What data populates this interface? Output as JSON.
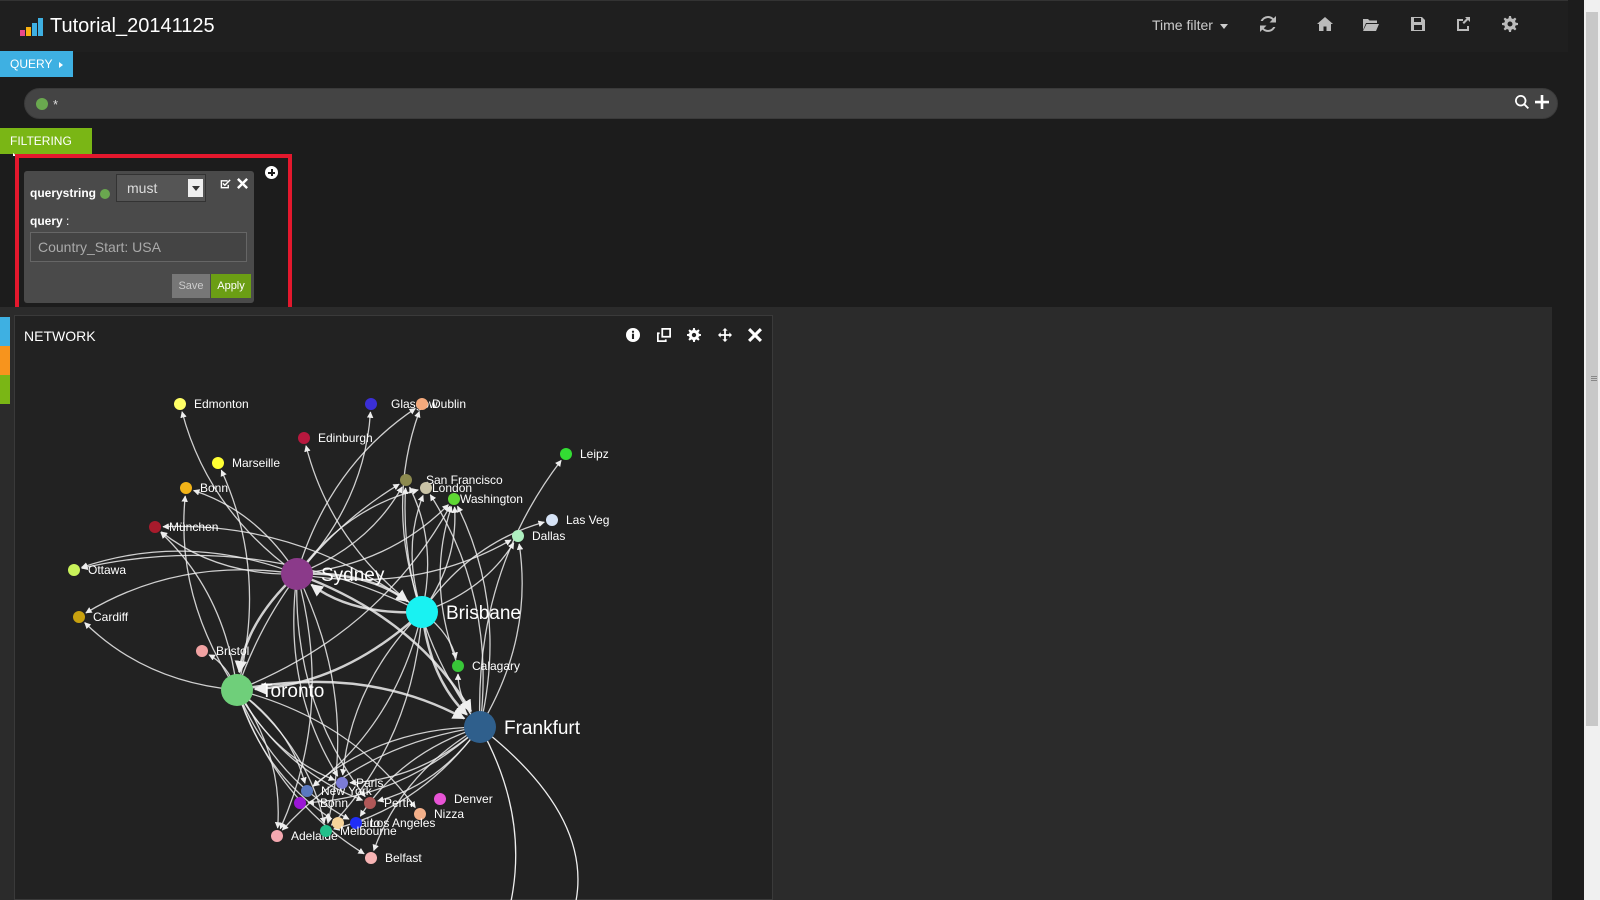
{
  "app": {
    "title": "Tutorial_20141125",
    "logo_icon": "kibana-bar-logo-icon"
  },
  "navbar": {
    "time_filter_label": "Time filter",
    "icons": [
      "refresh-icon",
      "home-icon",
      "folder-open-icon",
      "save-icon",
      "share-icon",
      "gear-icon"
    ]
  },
  "query_section": {
    "tab_label": "QUERY",
    "query_value": "*",
    "actions": [
      "search-icon",
      "plus-icon"
    ]
  },
  "filtering_section": {
    "tab_label": "FILTERING",
    "filter": {
      "type_label": "querystring",
      "mode_value": "must",
      "query_label": "query",
      "query_suffix": " :",
      "query_value": "Country_Start: USA",
      "save_label": "Save",
      "apply_label": "Apply"
    }
  },
  "colors": {
    "query_tab": "#3eb0e2",
    "filter_tab": "#7ab615",
    "highlight": "#e3182d",
    "apply": "#6b9e14"
  },
  "network_panel": {
    "title": "NETWORK",
    "tools": [
      "info-icon",
      "copy-icon",
      "gear-icon",
      "move-icon",
      "close-icon"
    ],
    "nodes": [
      {
        "id": "Edmonton",
        "label": "Edmonton",
        "color": "#ffff66",
        "size": "small"
      },
      {
        "id": "Glasgow",
        "label": "Glasgow",
        "color": "#3b2fd6",
        "size": "small"
      },
      {
        "id": "Dublin",
        "label": "Dublin",
        "color": "#f4a97c",
        "size": "small"
      },
      {
        "id": "Edinburgh",
        "label": "Edinburgh",
        "color": "#b8183e",
        "size": "small"
      },
      {
        "id": "Leipz",
        "label": "Leipz",
        "color": "#33dd33",
        "size": "small"
      },
      {
        "id": "Marseille",
        "label": "Marseille",
        "color": "#ffff33",
        "size": "small"
      },
      {
        "id": "SanFrancisco",
        "label": "San Francisco",
        "color": "#8c8a4f",
        "size": "small"
      },
      {
        "id": "London",
        "label": "London",
        "color": "#c9c3a6",
        "size": "small"
      },
      {
        "id": "Washington",
        "label": "Washington",
        "color": "#5fd833",
        "size": "small"
      },
      {
        "id": "Bonn",
        "label": "Bonn",
        "color": "#f2b318",
        "size": "small"
      },
      {
        "id": "LasVeg",
        "label": "Las Veg",
        "color": "#d6e3f6",
        "size": "small"
      },
      {
        "id": "Dallas",
        "label": "Dallas",
        "color": "#aef0c0",
        "size": "small"
      },
      {
        "id": "Munchen",
        "label": "München",
        "color": "#a81b2c",
        "size": "small"
      },
      {
        "id": "Sydney",
        "label": "Sydney",
        "color": "#8b3a8a",
        "size": "large"
      },
      {
        "id": "Ottawa",
        "label": "Ottawa",
        "color": "#c9f25a",
        "size": "small"
      },
      {
        "id": "Brisbane",
        "label": "Brisbane",
        "color": "#19f2f2",
        "size": "large"
      },
      {
        "id": "Cardiff",
        "label": "Cardiff",
        "color": "#c8a10f",
        "size": "small"
      },
      {
        "id": "Bristol",
        "label": "Bristol",
        "color": "#f2a3a3",
        "size": "small"
      },
      {
        "id": "Calagary",
        "label": "Calagary",
        "color": "#38c738",
        "size": "small"
      },
      {
        "id": "Toronto",
        "label": "Toronto",
        "color": "#6fcf7a",
        "size": "large"
      },
      {
        "id": "Frankfurt",
        "label": "Frankfurt",
        "color": "#2f5f8c",
        "size": "large"
      },
      {
        "id": "Paris",
        "label": "Paris",
        "color": "#7c7cd6",
        "size": "small"
      },
      {
        "id": "NewYork",
        "label": "New York",
        "color": "#5a78c0",
        "size": "small"
      },
      {
        "id": "Denver",
        "label": "Denver",
        "color": "#e854d6",
        "size": "small"
      },
      {
        "id": "Bonn2",
        "label": "Bonn",
        "color": "#9b16d6",
        "size": "small"
      },
      {
        "id": "Perth",
        "label": "Perth",
        "color": "#b05858",
        "size": "small"
      },
      {
        "id": "Nizza",
        "label": "Nizza",
        "color": "#f4b08a",
        "size": "small"
      },
      {
        "id": "Kairo",
        "label": "Kairo",
        "color": "#f7d49a",
        "size": "small"
      },
      {
        "id": "LosAngeles",
        "label": "Los Angeles",
        "color": "#1f2df7",
        "size": "small"
      },
      {
        "id": "Adelaide",
        "label": "Adelaide",
        "color": "#f5a8b0",
        "size": "small"
      },
      {
        "id": "Melbourne",
        "label": "Melbourne",
        "color": "#22c08a",
        "size": "small"
      },
      {
        "id": "Belfast",
        "label": "Belfast",
        "color": "#f7b4b4",
        "size": "small"
      }
    ],
    "edges": [
      [
        "Sydney",
        "Edmonton"
      ],
      [
        "Sydney",
        "Glasgow"
      ],
      [
        "Sydney",
        "Dublin"
      ],
      [
        "Sydney",
        "SanFrancisco"
      ],
      [
        "Sydney",
        "London"
      ],
      [
        "Sydney",
        "Washington"
      ],
      [
        "Sydney",
        "Munchen"
      ],
      [
        "Sydney",
        "Bonn"
      ],
      [
        "Sydney",
        "Brisbane"
      ],
      [
        "Sydney",
        "Toronto"
      ],
      [
        "Sydney",
        "Frankfurt"
      ],
      [
        "Sydney",
        "Paris"
      ],
      [
        "Sydney",
        "Melbourne"
      ],
      [
        "Sydney",
        "Perth"
      ],
      [
        "Sydney",
        "Adelaide"
      ],
      [
        "Sydney",
        "Dallas"
      ],
      [
        "Brisbane",
        "Edinburgh"
      ],
      [
        "Brisbane",
        "SanFrancisco"
      ],
      [
        "Brisbane",
        "London"
      ],
      [
        "Brisbane",
        "Washington"
      ],
      [
        "Brisbane",
        "LasVeg"
      ],
      [
        "Brisbane",
        "Dallas"
      ],
      [
        "Brisbane",
        "Calagary"
      ],
      [
        "Brisbane",
        "Frankfurt"
      ],
      [
        "Brisbane",
        "Toronto"
      ],
      [
        "Brisbane",
        "Paris"
      ],
      [
        "Brisbane",
        "NewYork"
      ],
      [
        "Brisbane",
        "Munchen"
      ],
      [
        "Brisbane",
        "Melbourne"
      ],
      [
        "Brisbane",
        "Ottawa"
      ],
      [
        "Brisbane",
        "Dublin"
      ],
      [
        "Toronto",
        "Marseille"
      ],
      [
        "Toronto",
        "Bonn"
      ],
      [
        "Toronto",
        "Munchen"
      ],
      [
        "Toronto",
        "Cardiff"
      ],
      [
        "Toronto",
        "Bristol"
      ],
      [
        "Toronto",
        "SanFrancisco"
      ],
      [
        "Toronto",
        "Washington"
      ],
      [
        "Toronto",
        "Frankfurt"
      ],
      [
        "Toronto",
        "Paris"
      ],
      [
        "Toronto",
        "NewYork"
      ],
      [
        "Toronto",
        "Perth"
      ],
      [
        "Toronto",
        "Melbourne"
      ],
      [
        "Toronto",
        "LosAngeles"
      ],
      [
        "Toronto",
        "Adelaide"
      ],
      [
        "Toronto",
        "Belfast"
      ],
      [
        "Toronto",
        "Nizza"
      ],
      [
        "Toronto",
        "Kairo"
      ],
      [
        "Frankfurt",
        "Leipz"
      ],
      [
        "Frankfurt",
        "Dallas"
      ],
      [
        "Frankfurt",
        "SanFrancisco"
      ],
      [
        "Frankfurt",
        "London"
      ],
      [
        "Frankfurt",
        "Paris"
      ],
      [
        "Frankfurt",
        "NewYork"
      ],
      [
        "Frankfurt",
        "Perth"
      ],
      [
        "Frankfurt",
        "LosAngeles"
      ],
      [
        "Frankfurt",
        "Melbourne"
      ],
      [
        "Frankfurt",
        "Belfast"
      ],
      [
        "Frankfurt",
        "Bonn2"
      ],
      [
        "Frankfurt",
        "Adelaide"
      ],
      [
        "Frankfurt",
        "Calagary"
      ],
      [
        "Frankfurt",
        "Washington"
      ],
      [
        "Calagary",
        "Washington"
      ],
      [
        "Sydney",
        "Ottawa"
      ],
      [
        "Brisbane",
        "Sydney"
      ],
      [
        "Sydney",
        "Cardiff"
      ]
    ]
  }
}
